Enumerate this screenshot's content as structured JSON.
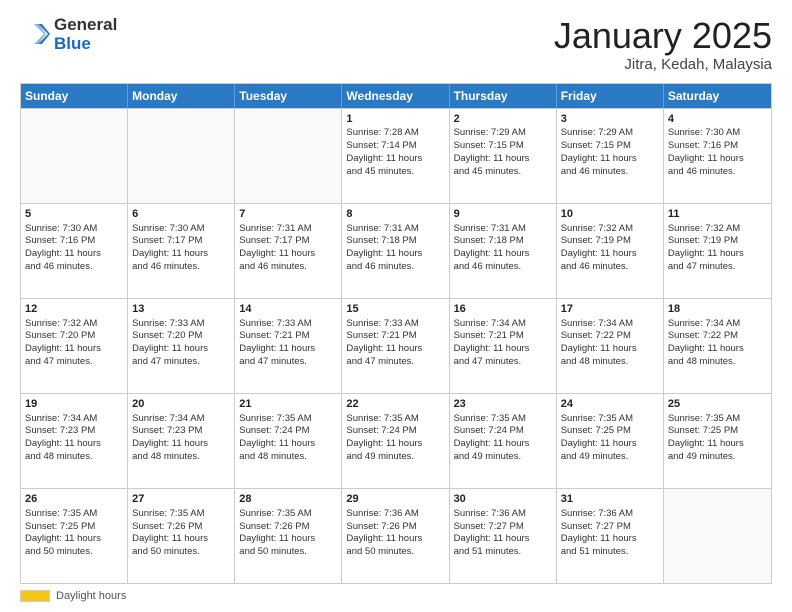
{
  "header": {
    "logo_general": "General",
    "logo_blue": "Blue",
    "title": "January 2025",
    "location": "Jitra, Kedah, Malaysia"
  },
  "footer": {
    "label": "Daylight hours"
  },
  "calendar": {
    "days_of_week": [
      "Sunday",
      "Monday",
      "Tuesday",
      "Wednesday",
      "Thursday",
      "Friday",
      "Saturday"
    ],
    "rows": [
      [
        {
          "day": "",
          "lines": []
        },
        {
          "day": "",
          "lines": []
        },
        {
          "day": "",
          "lines": []
        },
        {
          "day": "1",
          "lines": [
            "Sunrise: 7:28 AM",
            "Sunset: 7:14 PM",
            "Daylight: 11 hours",
            "and 45 minutes."
          ]
        },
        {
          "day": "2",
          "lines": [
            "Sunrise: 7:29 AM",
            "Sunset: 7:15 PM",
            "Daylight: 11 hours",
            "and 45 minutes."
          ]
        },
        {
          "day": "3",
          "lines": [
            "Sunrise: 7:29 AM",
            "Sunset: 7:15 PM",
            "Daylight: 11 hours",
            "and 46 minutes."
          ]
        },
        {
          "day": "4",
          "lines": [
            "Sunrise: 7:30 AM",
            "Sunset: 7:16 PM",
            "Daylight: 11 hours",
            "and 46 minutes."
          ]
        }
      ],
      [
        {
          "day": "5",
          "lines": [
            "Sunrise: 7:30 AM",
            "Sunset: 7:16 PM",
            "Daylight: 11 hours",
            "and 46 minutes."
          ]
        },
        {
          "day": "6",
          "lines": [
            "Sunrise: 7:30 AM",
            "Sunset: 7:17 PM",
            "Daylight: 11 hours",
            "and 46 minutes."
          ]
        },
        {
          "day": "7",
          "lines": [
            "Sunrise: 7:31 AM",
            "Sunset: 7:17 PM",
            "Daylight: 11 hours",
            "and 46 minutes."
          ]
        },
        {
          "day": "8",
          "lines": [
            "Sunrise: 7:31 AM",
            "Sunset: 7:18 PM",
            "Daylight: 11 hours",
            "and 46 minutes."
          ]
        },
        {
          "day": "9",
          "lines": [
            "Sunrise: 7:31 AM",
            "Sunset: 7:18 PM",
            "Daylight: 11 hours",
            "and 46 minutes."
          ]
        },
        {
          "day": "10",
          "lines": [
            "Sunrise: 7:32 AM",
            "Sunset: 7:19 PM",
            "Daylight: 11 hours",
            "and 46 minutes."
          ]
        },
        {
          "day": "11",
          "lines": [
            "Sunrise: 7:32 AM",
            "Sunset: 7:19 PM",
            "Daylight: 11 hours",
            "and 47 minutes."
          ]
        }
      ],
      [
        {
          "day": "12",
          "lines": [
            "Sunrise: 7:32 AM",
            "Sunset: 7:20 PM",
            "Daylight: 11 hours",
            "and 47 minutes."
          ]
        },
        {
          "day": "13",
          "lines": [
            "Sunrise: 7:33 AM",
            "Sunset: 7:20 PM",
            "Daylight: 11 hours",
            "and 47 minutes."
          ]
        },
        {
          "day": "14",
          "lines": [
            "Sunrise: 7:33 AM",
            "Sunset: 7:21 PM",
            "Daylight: 11 hours",
            "and 47 minutes."
          ]
        },
        {
          "day": "15",
          "lines": [
            "Sunrise: 7:33 AM",
            "Sunset: 7:21 PM",
            "Daylight: 11 hours",
            "and 47 minutes."
          ]
        },
        {
          "day": "16",
          "lines": [
            "Sunrise: 7:34 AM",
            "Sunset: 7:21 PM",
            "Daylight: 11 hours",
            "and 47 minutes."
          ]
        },
        {
          "day": "17",
          "lines": [
            "Sunrise: 7:34 AM",
            "Sunset: 7:22 PM",
            "Daylight: 11 hours",
            "and 48 minutes."
          ]
        },
        {
          "day": "18",
          "lines": [
            "Sunrise: 7:34 AM",
            "Sunset: 7:22 PM",
            "Daylight: 11 hours",
            "and 48 minutes."
          ]
        }
      ],
      [
        {
          "day": "19",
          "lines": [
            "Sunrise: 7:34 AM",
            "Sunset: 7:23 PM",
            "Daylight: 11 hours",
            "and 48 minutes."
          ]
        },
        {
          "day": "20",
          "lines": [
            "Sunrise: 7:34 AM",
            "Sunset: 7:23 PM",
            "Daylight: 11 hours",
            "and 48 minutes."
          ]
        },
        {
          "day": "21",
          "lines": [
            "Sunrise: 7:35 AM",
            "Sunset: 7:24 PM",
            "Daylight: 11 hours",
            "and 48 minutes."
          ]
        },
        {
          "day": "22",
          "lines": [
            "Sunrise: 7:35 AM",
            "Sunset: 7:24 PM",
            "Daylight: 11 hours",
            "and 49 minutes."
          ]
        },
        {
          "day": "23",
          "lines": [
            "Sunrise: 7:35 AM",
            "Sunset: 7:24 PM",
            "Daylight: 11 hours",
            "and 49 minutes."
          ]
        },
        {
          "day": "24",
          "lines": [
            "Sunrise: 7:35 AM",
            "Sunset: 7:25 PM",
            "Daylight: 11 hours",
            "and 49 minutes."
          ]
        },
        {
          "day": "25",
          "lines": [
            "Sunrise: 7:35 AM",
            "Sunset: 7:25 PM",
            "Daylight: 11 hours",
            "and 49 minutes."
          ]
        }
      ],
      [
        {
          "day": "26",
          "lines": [
            "Sunrise: 7:35 AM",
            "Sunset: 7:25 PM",
            "Daylight: 11 hours",
            "and 50 minutes."
          ]
        },
        {
          "day": "27",
          "lines": [
            "Sunrise: 7:35 AM",
            "Sunset: 7:26 PM",
            "Daylight: 11 hours",
            "and 50 minutes."
          ]
        },
        {
          "day": "28",
          "lines": [
            "Sunrise: 7:35 AM",
            "Sunset: 7:26 PM",
            "Daylight: 11 hours",
            "and 50 minutes."
          ]
        },
        {
          "day": "29",
          "lines": [
            "Sunrise: 7:36 AM",
            "Sunset: 7:26 PM",
            "Daylight: 11 hours",
            "and 50 minutes."
          ]
        },
        {
          "day": "30",
          "lines": [
            "Sunrise: 7:36 AM",
            "Sunset: 7:27 PM",
            "Daylight: 11 hours",
            "and 51 minutes."
          ]
        },
        {
          "day": "31",
          "lines": [
            "Sunrise: 7:36 AM",
            "Sunset: 7:27 PM",
            "Daylight: 11 hours",
            "and 51 minutes."
          ]
        },
        {
          "day": "",
          "lines": []
        }
      ]
    ]
  }
}
